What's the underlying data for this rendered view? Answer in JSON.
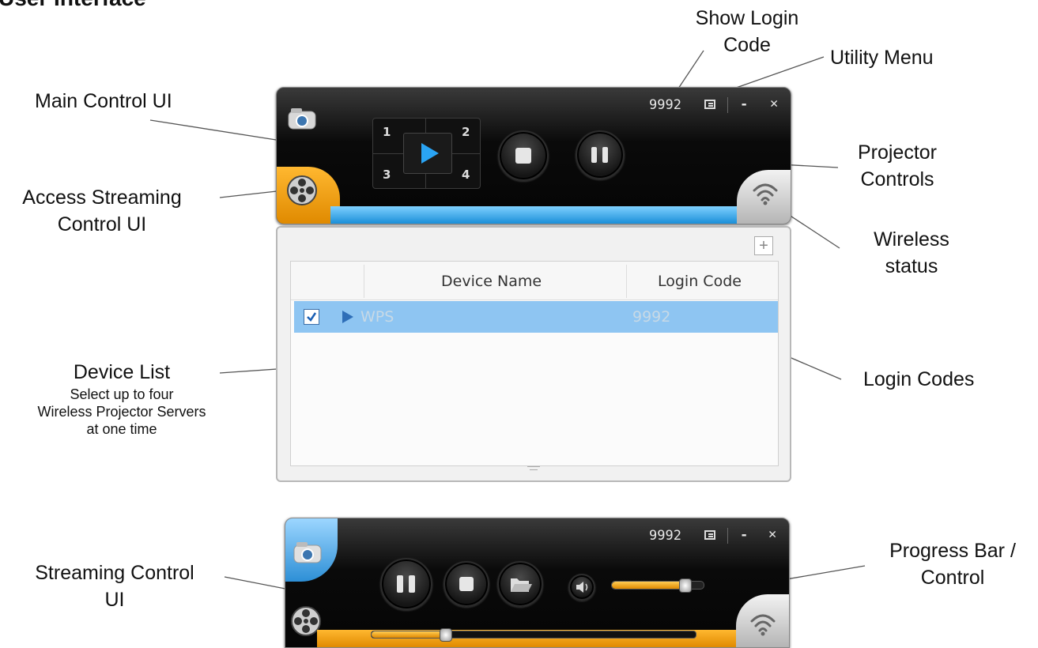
{
  "heading": "User Interface",
  "labels": {
    "show_login_code": [
      "Show Login",
      "Code"
    ],
    "utility_menu": "Utility Menu",
    "main_control_ui": "Main Control UI",
    "projector_controls": [
      "Projector",
      "Controls"
    ],
    "access_streaming": [
      "Access Streaming",
      "Control UI"
    ],
    "wireless_status": [
      "Wireless",
      "status"
    ],
    "device_list": "Device List",
    "device_list_desc": [
      "Select up to four",
      "Wireless Projector Servers",
      "at one time"
    ],
    "login_codes": "Login Codes",
    "streaming_control_ui": [
      "Streaming Control",
      "UI"
    ],
    "progress_bar": [
      "Progress Bar /",
      "Control"
    ]
  },
  "main_panel": {
    "login_code": "9992",
    "utility_icon": "utility-menu-icon",
    "minimize": "-",
    "close": "✕",
    "quadrants": [
      "1",
      "2",
      "3",
      "4"
    ]
  },
  "device_list": {
    "add_button": "+",
    "columns": [
      "Device Name",
      "Login Code"
    ],
    "rows": [
      {
        "checked": true,
        "name": "WPS",
        "code": "9992"
      }
    ]
  },
  "stream_panel": {
    "login_code": "9992",
    "minimize": "-",
    "close": "✕",
    "volume": 0.8,
    "progress": 0.23
  },
  "colors": {
    "accent_blue": "#1a8ed8",
    "accent_orange": "#f0a010",
    "row_select": "#8ec5f2"
  }
}
